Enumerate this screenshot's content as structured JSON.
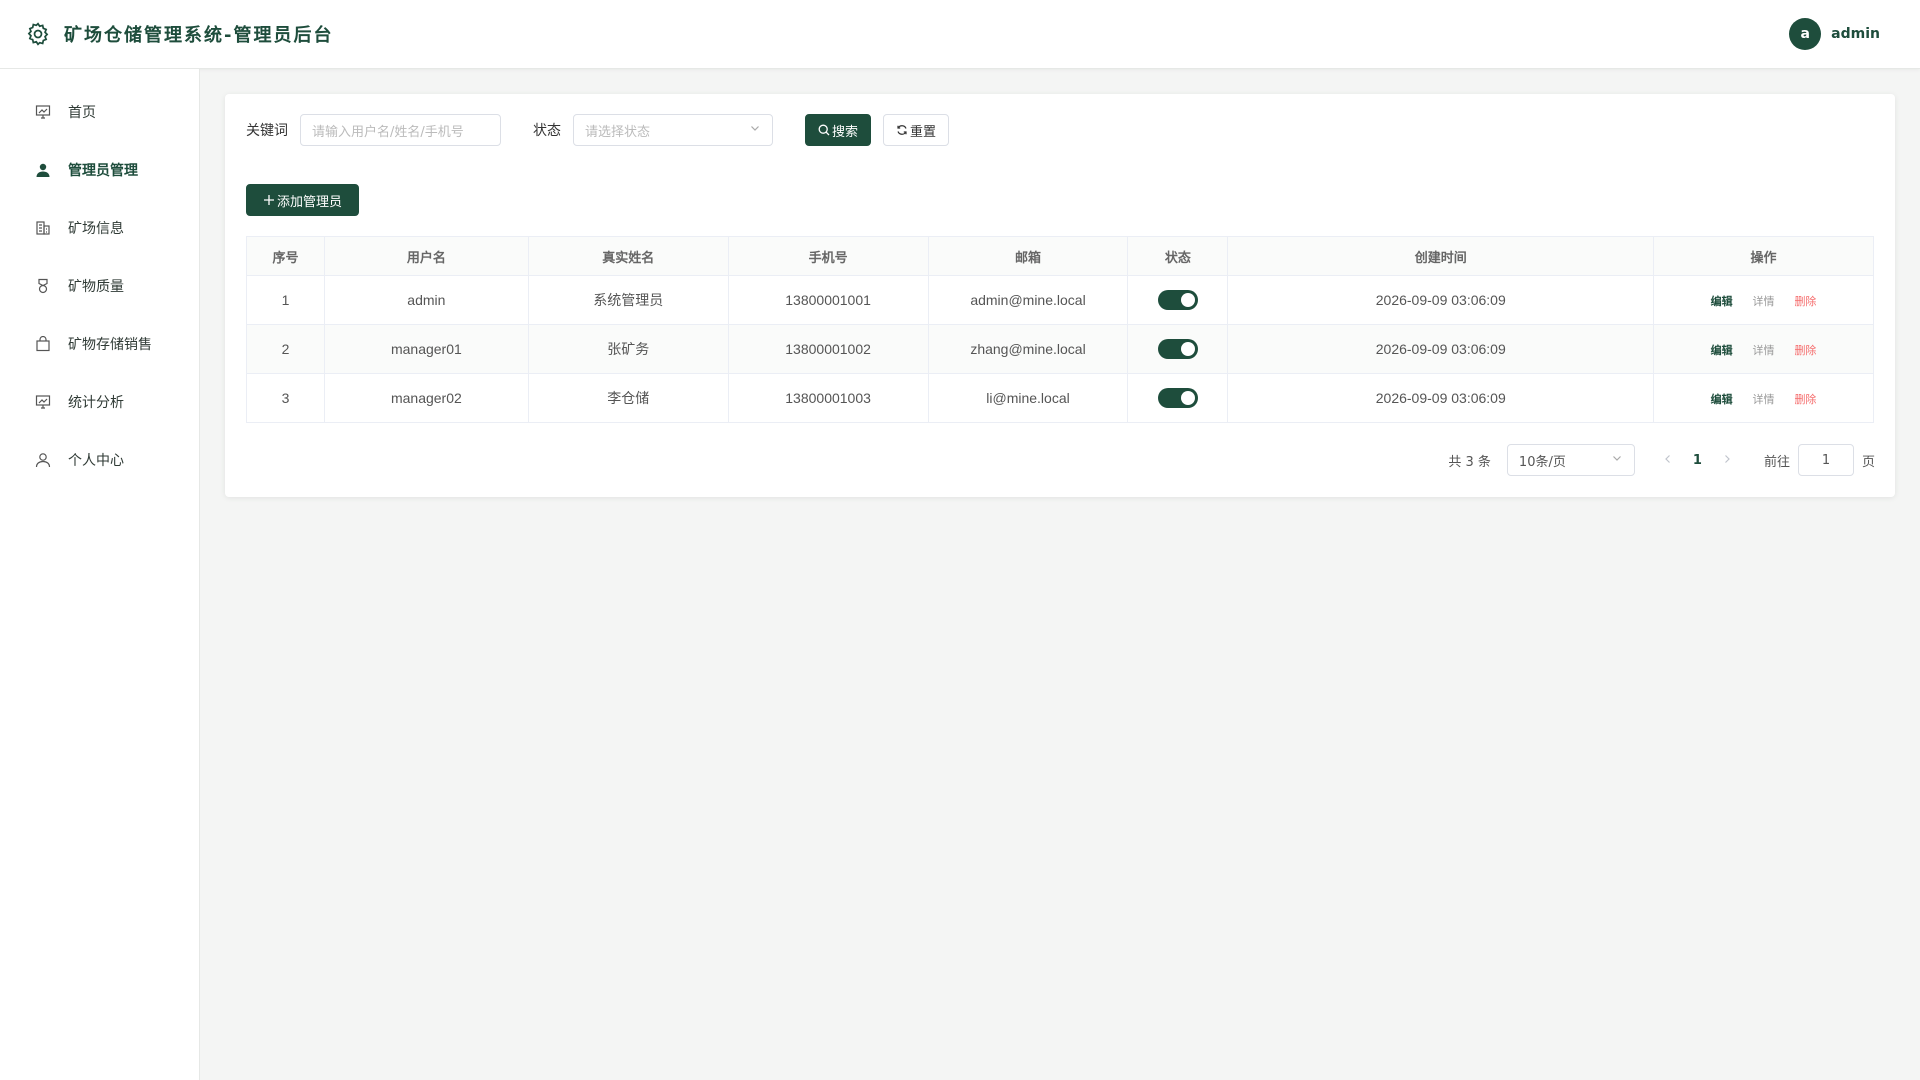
{
  "header": {
    "logo_icon": "gear-icon",
    "title": "矿场仓储管理系统-管理员后台",
    "avatar_letter": "a",
    "username": "admin"
  },
  "sidebar": {
    "items": [
      {
        "label": "首页",
        "icon": "dashboard-icon"
      },
      {
        "label": "管理员管理",
        "icon": "user-icon",
        "active": true
      },
      {
        "label": "矿场信息",
        "icon": "building-icon"
      },
      {
        "label": "矿物质量",
        "icon": "medal-icon"
      },
      {
        "label": "矿物存储销售",
        "icon": "shopping-bag-icon"
      },
      {
        "label": "统计分析",
        "icon": "chart-board-icon"
      },
      {
        "label": "个人中心",
        "icon": "person-icon"
      }
    ]
  },
  "search": {
    "keyword_label": "关键词",
    "keyword_placeholder": "请输入用户名/姓名/手机号",
    "status_label": "状态",
    "status_placeholder": "请选择状态",
    "search_button": "搜索",
    "reset_button": "重置"
  },
  "toolbar": {
    "add_button": "添加管理员"
  },
  "table": {
    "columns": [
      "序号",
      "用户名",
      "真实姓名",
      "手机号",
      "邮箱",
      "状态",
      "创建时间",
      "操作"
    ],
    "rows": [
      {
        "index": "1",
        "username": "admin",
        "realname": "系统管理员",
        "phone": "13800001001",
        "email": "admin@mine.local",
        "enabled": true,
        "created": "2026-09-09 03:06:09"
      },
      {
        "index": "2",
        "username": "manager01",
        "realname": "张矿务",
        "phone": "13800001002",
        "email": "zhang@mine.local",
        "enabled": true,
        "created": "2026-09-09 03:06:09"
      },
      {
        "index": "3",
        "username": "manager02",
        "realname": "李仓储",
        "phone": "13800001003",
        "email": "li@mine.local",
        "enabled": true,
        "created": "2026-09-09 03:06:09"
      }
    ],
    "ops": {
      "edit": "编辑",
      "detail": "详情",
      "delete": "删除"
    }
  },
  "pagination": {
    "total": "共 3 条",
    "page_size": "10条/页",
    "current_page": "1",
    "goto_label": "前往",
    "goto_value": "1",
    "page_suffix": "页"
  },
  "colors": {
    "primary": "#1e4d3c",
    "danger": "#f56c6c"
  }
}
